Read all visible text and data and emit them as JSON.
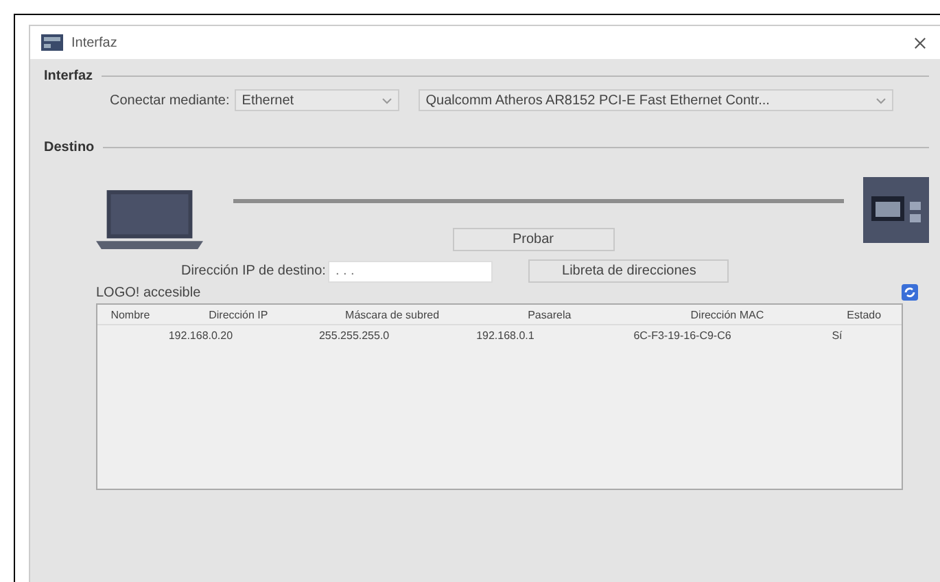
{
  "window": {
    "title": "Interfaz"
  },
  "interface_section": {
    "title": "Interfaz",
    "connect_label": "Conectar mediante:",
    "connection": "Ethernet",
    "adapter": "Qualcomm Atheros AR8152 PCI-E Fast Ethernet Contr..."
  },
  "destination_section": {
    "title": "Destino",
    "test_button": "Probar",
    "ip_label": "Dirección IP de destino:",
    "ip_placeholder": ". . .",
    "address_book_button": "Libreta de direcciones",
    "accessible_label": "LOGO! accesible"
  },
  "table": {
    "columns": [
      "Nombre",
      "Dirección IP",
      "Máscara de subred",
      "Pasarela",
      "Dirección MAC",
      "Estado"
    ],
    "rows": [
      [
        "",
        "192.168.0.20",
        "255.255.255.0",
        "192.168.0.1",
        "6C-F3-19-16-C9-C6",
        "Sí"
      ]
    ]
  }
}
